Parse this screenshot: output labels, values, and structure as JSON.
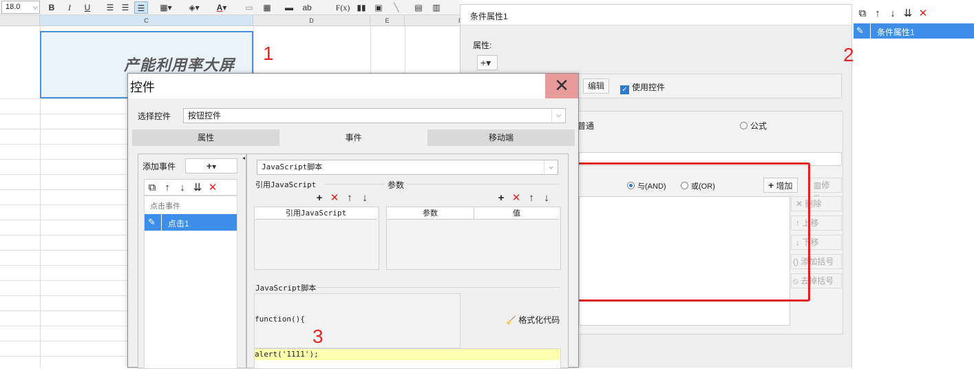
{
  "toolbar": {
    "font_size": "18.0",
    "bold": "B",
    "italic": "I",
    "underline": "U",
    "font_color": "A",
    "text_ab": "ab",
    "fx": "F(x)"
  },
  "sheet": {
    "columns": [
      "C",
      "D",
      "E",
      "F"
    ],
    "big_cell_text": "产能利用率大屏",
    "marks": [
      "1",
      "2",
      "3"
    ]
  },
  "condition_panel": {
    "window_title": "条件属性1",
    "property_label": "属性:",
    "edit_button": "编辑",
    "use_control_label": "使用控件",
    "radio_normal": "普通",
    "radio_formula": "公式",
    "and_label": "与(AND)",
    "or_label": "或(OR)",
    "add_button": "增加",
    "modify_button": "修改",
    "delete_button": "删除",
    "move_up_button": "上移",
    "move_down_button": "下移",
    "add_bracket_button": "添加括号",
    "remove_bracket_button": "去掉括号"
  },
  "right_list": {
    "items": [
      "条件属性1"
    ]
  },
  "dialog": {
    "title": "控件",
    "select_label": "选择控件",
    "select_value": "按钮控件",
    "tabs": [
      "属性",
      "事件",
      "移动端"
    ],
    "active_tab": "事件",
    "add_event_label": "添加事件",
    "event_group": "点击事件",
    "events": [
      "点击1"
    ],
    "script_type": "JavaScript脚本",
    "ref_js_label": "引用JavaScript",
    "params_label": "参数",
    "ref_js_col": "引用JavaScript",
    "param_col": "参数",
    "value_col": "值",
    "js_script_label": "JavaScript脚本",
    "function_header": "function(){",
    "format_code": "格式化代码",
    "code_line": "alert('1111');"
  },
  "colors": {
    "selection_blue": "#3d8ee8",
    "annotation_red": "#e22222",
    "close_hover": "#e89b9b",
    "highlight_line": "#ffffb0"
  }
}
